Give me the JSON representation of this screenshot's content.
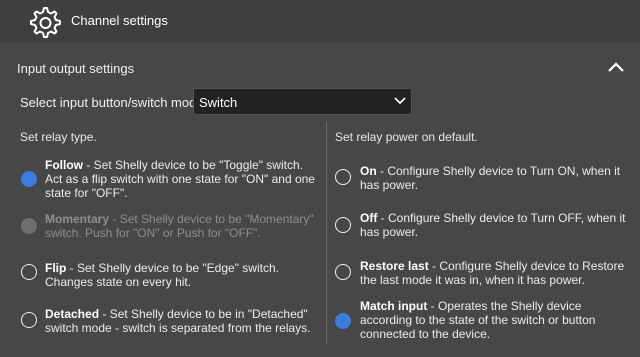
{
  "header": {
    "title": "Channel settings",
    "icon": "gear-icon"
  },
  "section": {
    "title": "Input output settings"
  },
  "mode": {
    "label": "Select input button/switch mode.",
    "value": "Switch"
  },
  "relay_type": {
    "title": "Set relay type.",
    "options": [
      {
        "name": "Follow",
        "desc": "- Set Shelly device to be \"Toggle\" switch.",
        "desc2": "Act as a flip switch with one state for \"ON\" and one",
        "desc3": "state for \"OFF\".",
        "selected": true,
        "disabled": false
      },
      {
        "name": "Momentary",
        "desc": "- Set Shelly device to be \"Momentary\"",
        "desc2": "switch. Push for \"ON\" or Push for \"OFF\".",
        "selected": false,
        "disabled": true
      },
      {
        "name": "Flip",
        "desc": "- Set Shelly device to be \"Edge\" switch.",
        "desc2": "Changes state on every hit.",
        "selected": false,
        "disabled": false
      },
      {
        "name": "Detached",
        "desc": "- Set Shelly device to be in \"Detached\"",
        "desc2": "switch mode - switch is separated from the relays.",
        "selected": false,
        "disabled": false
      }
    ]
  },
  "power_default": {
    "title": "Set relay power on default.",
    "options": [
      {
        "name": "On",
        "desc": "- Configure Shelly device to Turn ON, when it",
        "desc2": "has power.",
        "selected": false
      },
      {
        "name": "Off",
        "desc": "- Configure Shelly device to Turn OFF, when it",
        "desc2": "has power.",
        "selected": false
      },
      {
        "name": "Restore last",
        "desc": "- Configure Shelly device to Restore",
        "desc2": "the last mode it was in, when it has power.",
        "selected": false
      },
      {
        "name": "Match input",
        "desc": "- Operates the Shelly device",
        "desc2": "according to the state of the switch or button",
        "desc3": "connected to the device.",
        "selected": true
      }
    ]
  },
  "colors": {
    "accent": "#3b7ddd",
    "background": "#474747",
    "header": "#3f3f3f",
    "select_bg": "#222222"
  }
}
